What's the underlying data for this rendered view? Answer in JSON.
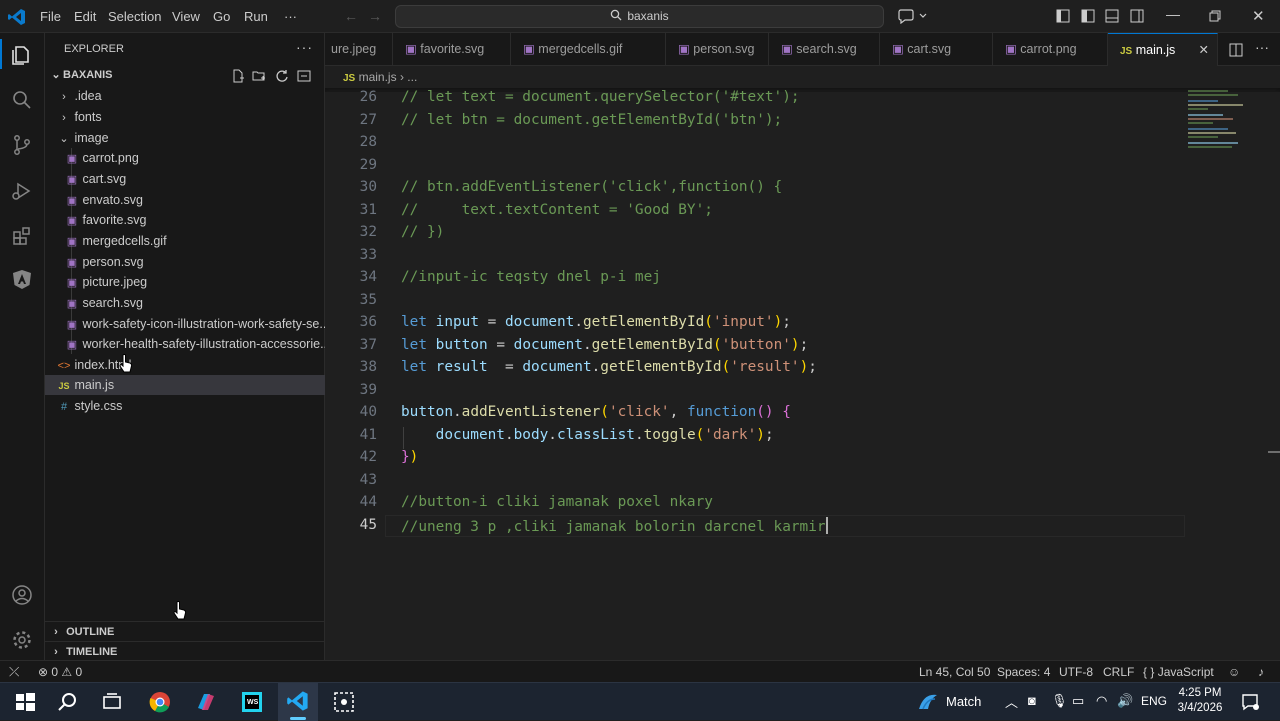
{
  "titlebar": {
    "menus": [
      "File",
      "Edit",
      "Selection",
      "View",
      "Go",
      "Run",
      "···"
    ],
    "search_text": "baxanis"
  },
  "sidebar": {
    "header": "EXPLORER",
    "project": "BAXANIS",
    "items": [
      {
        "label": ".idea",
        "kind": "folder-closed"
      },
      {
        "label": "fonts",
        "kind": "folder-closed"
      },
      {
        "label": "image",
        "kind": "folder-open"
      },
      {
        "label": "carrot.png",
        "kind": "image"
      },
      {
        "label": "cart.svg",
        "kind": "image"
      },
      {
        "label": "envato.svg",
        "kind": "image"
      },
      {
        "label": "favorite.svg",
        "kind": "image"
      },
      {
        "label": "mergedcells.gif",
        "kind": "image"
      },
      {
        "label": "person.svg",
        "kind": "image"
      },
      {
        "label": "picture.jpeg",
        "kind": "image"
      },
      {
        "label": "search.svg",
        "kind": "image"
      },
      {
        "label": "work-safety-icon-illustration-work-safety-se...",
        "kind": "image"
      },
      {
        "label": "worker-health-safety-illustration-accessorie...",
        "kind": "image"
      },
      {
        "label": "index.html",
        "kind": "html"
      },
      {
        "label": "main.js",
        "kind": "js"
      },
      {
        "label": "style.css",
        "kind": "css"
      }
    ],
    "outline": "OUTLINE",
    "timeline": "TIMELINE"
  },
  "tabs": [
    "ure.jpeg",
    "favorite.svg",
    "mergedcells.gif",
    "person.svg",
    "search.svg",
    "cart.svg",
    "carrot.png",
    "main.js"
  ],
  "breadcrumb": {
    "file": "main.js",
    "rest": "..."
  },
  "editor": {
    "lines": [
      {
        "n": "26",
        "t": "// let text = document.querySelector('#text');"
      },
      {
        "n": "27",
        "t": "// let btn = document.getElementById('btn');"
      },
      {
        "n": "28",
        "t": ""
      },
      {
        "n": "29",
        "t": ""
      },
      {
        "n": "30",
        "t": "// btn.addEventListener('click',function() {"
      },
      {
        "n": "31",
        "t": "//     text.textContent = 'Good BY';"
      },
      {
        "n": "32",
        "t": "// })"
      },
      {
        "n": "33",
        "t": ""
      },
      {
        "n": "34",
        "t": "//input-ic teqsty dnel p-i mej"
      },
      {
        "n": "35",
        "t": ""
      },
      {
        "n": "36",
        "t": "let input = document.getElementById('input');"
      },
      {
        "n": "37",
        "t": "let button = document.getElementById('button');"
      },
      {
        "n": "38",
        "t": "let result  = document.getElementById('result');"
      },
      {
        "n": "39",
        "t": ""
      },
      {
        "n": "40",
        "t": "button.addEventListener('click', function() {"
      },
      {
        "n": "41",
        "t": "    document.body.classList.toggle('dark');"
      },
      {
        "n": "42",
        "t": "})"
      },
      {
        "n": "43",
        "t": ""
      },
      {
        "n": "44",
        "t": "//button-i cliki jamanak poxel nkary"
      },
      {
        "n": "45",
        "t": "//uneng 3 p ,cliki jamanak bolorin darcnel karmir"
      }
    ]
  },
  "statusbar": {
    "problems": "0",
    "warnings": "0",
    "position": "Ln 45, Col 50",
    "spaces": "Spaces: 4",
    "encoding": "UTF-8",
    "eol": "CRLF",
    "language": "JavaScript"
  },
  "taskbar": {
    "weather": "Match",
    "lang": "ENG",
    "time": "4:25 PM",
    "date": "3/4/2026"
  }
}
